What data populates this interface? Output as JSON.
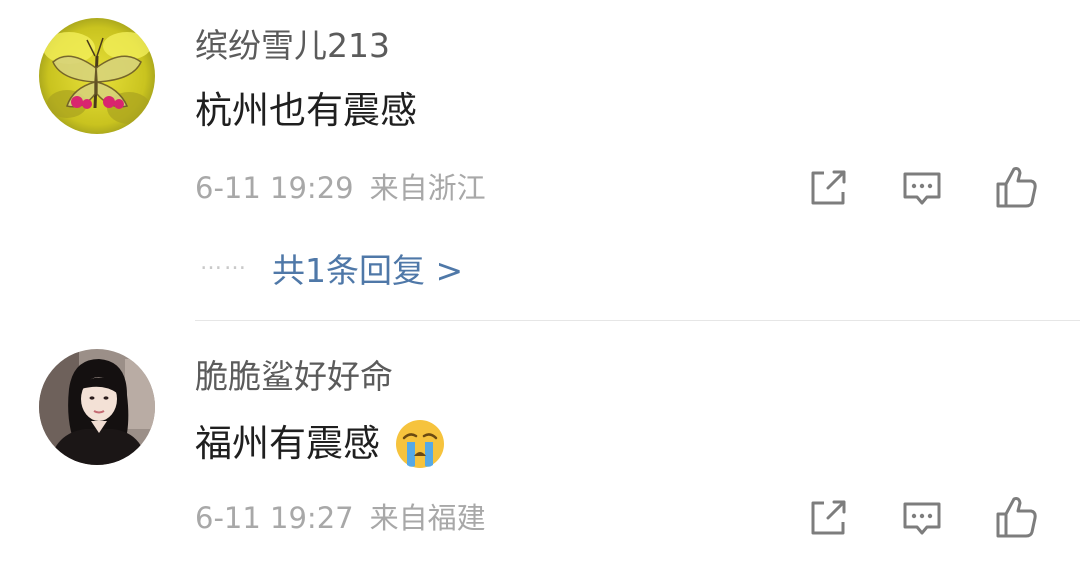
{
  "comments": [
    {
      "username": "缤纷雪儿213",
      "text": "杭州也有震感",
      "time": "6-11 19:29",
      "location": "来自浙江",
      "reply_link": "共1条回复 >",
      "reply_dots": "……"
    },
    {
      "username": "脆脆鲨好好命",
      "text": "福州有震感",
      "time": "6-11 19:27",
      "location": "来自福建"
    }
  ],
  "icons": {
    "share": "share-icon",
    "comment": "comment-icon",
    "like": "like-icon",
    "emoji": "crying-face-emoji"
  },
  "colors": {
    "link": "#4f78a8",
    "meta": "#a8a8a8",
    "username": "#5b5b5b",
    "icon": "#7d7d7d"
  }
}
